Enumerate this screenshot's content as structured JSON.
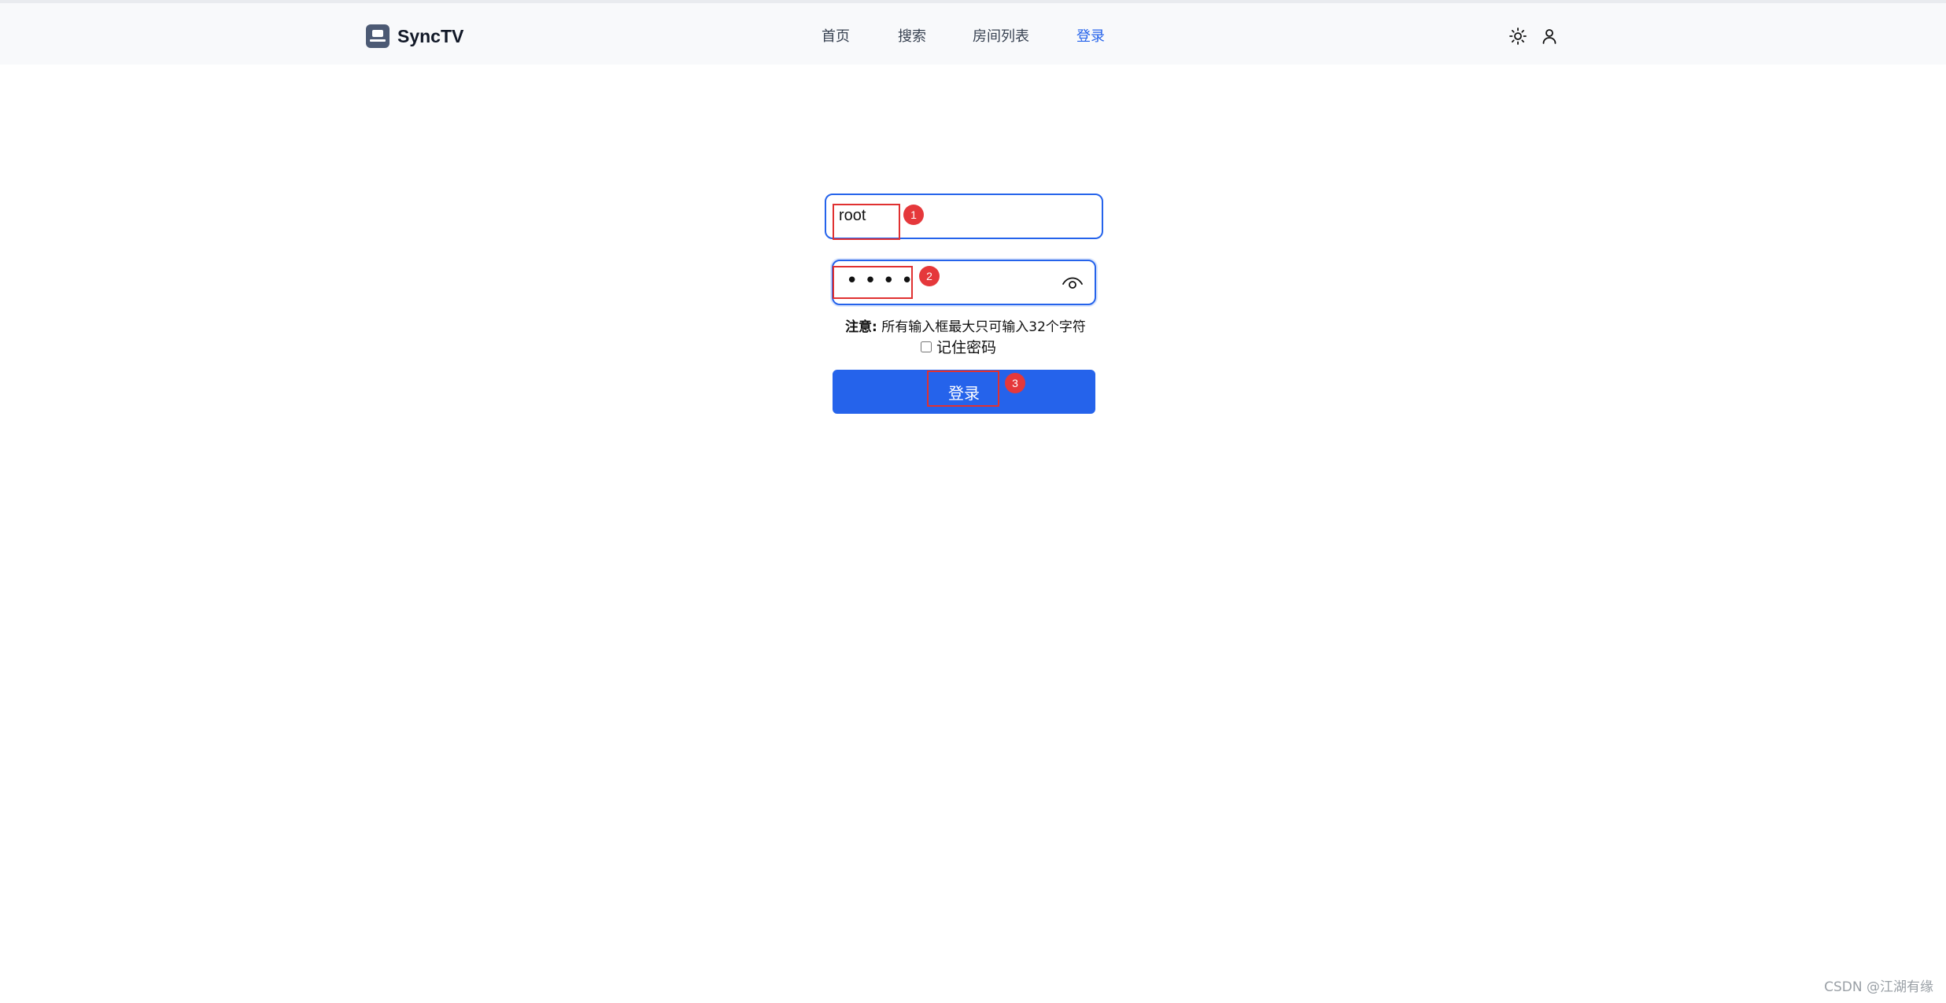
{
  "app": {
    "name": "SyncTV"
  },
  "nav": {
    "items": [
      {
        "label": "首页"
      },
      {
        "label": "搜索"
      },
      {
        "label": "房间列表"
      },
      {
        "label": "登录",
        "active": true
      }
    ]
  },
  "header_icons": [
    "sun-icon",
    "user-icon"
  ],
  "login_form": {
    "username_value": "root",
    "password_mask": "••••",
    "note_label": "注意:",
    "note_text": "所有输入框最大只可输入32个字符",
    "remember_label": "记住密码",
    "remember_checked": false,
    "submit_label": "登录"
  },
  "annotations": {
    "badges": [
      "1",
      "2",
      "3"
    ],
    "color": "#e5383b"
  },
  "watermark": "CSDN @江湖有缘",
  "colors": {
    "accent": "#2563eb",
    "header_bg": "#f8f9fb",
    "logo_bg": "#4c5a74"
  }
}
